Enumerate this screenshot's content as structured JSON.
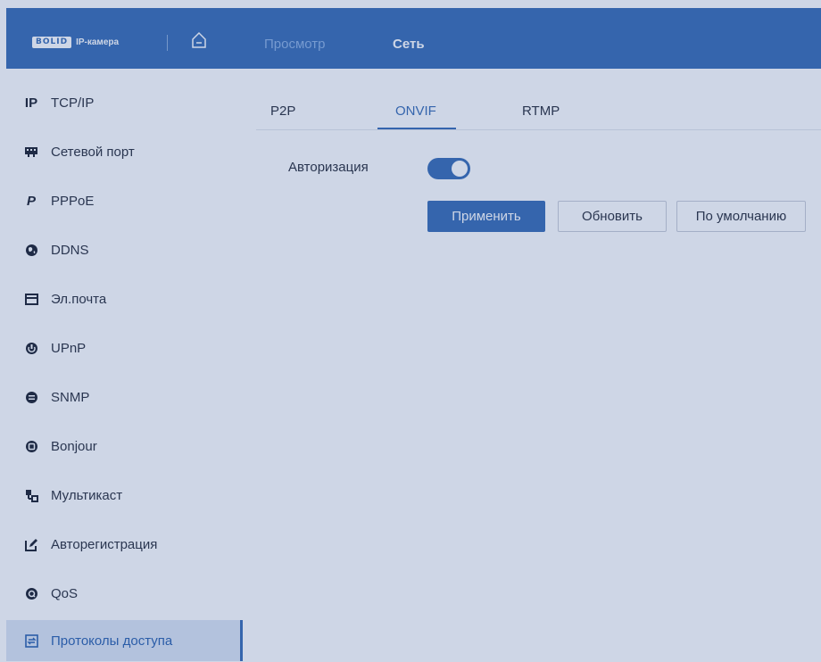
{
  "header": {
    "logo_brand": "BOLID",
    "logo_text": "IP-камера",
    "nav": [
      {
        "label": "Просмотр"
      },
      {
        "label": "Сеть"
      }
    ]
  },
  "sidebar": {
    "items": [
      {
        "label": "TCP/IP",
        "icon": "ip-icon"
      },
      {
        "label": "Сетевой порт",
        "icon": "network-port-icon"
      },
      {
        "label": "PPPoE",
        "icon": "pppoe-icon"
      },
      {
        "label": "DDNS",
        "icon": "globe-icon"
      },
      {
        "label": "Эл.почта",
        "icon": "mail-icon"
      },
      {
        "label": "UPnP",
        "icon": "power-icon"
      },
      {
        "label": "SNMP",
        "icon": "snmp-icon"
      },
      {
        "label": "Bonjour",
        "icon": "bonjour-icon"
      },
      {
        "label": "Мультикаст",
        "icon": "multicast-icon"
      },
      {
        "label": "Авторегистрация",
        "icon": "edit-icon"
      },
      {
        "label": "QoS",
        "icon": "qos-icon"
      },
      {
        "label": "Протоколы доступа",
        "icon": "access-protocols-icon",
        "active": true
      }
    ]
  },
  "main": {
    "tabs": [
      {
        "label": "P2P"
      },
      {
        "label": "ONVIF",
        "active": true
      },
      {
        "label": "RTMP"
      }
    ],
    "auth_label": "Авторизация",
    "auth_enabled": true,
    "buttons": {
      "apply": "Применить",
      "refresh": "Обновить",
      "default": "По умолчанию"
    }
  },
  "colors": {
    "accent": "#3b6fb6",
    "header_bg": "#3b6fb6"
  }
}
